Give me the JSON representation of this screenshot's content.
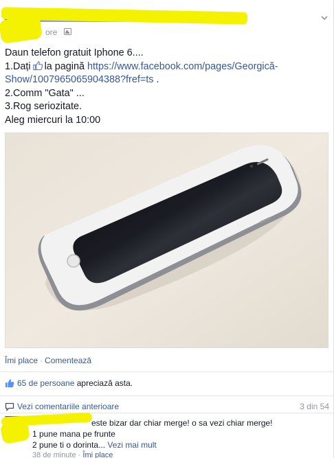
{
  "post": {
    "timestamp": "ore",
    "lines": {
      "l1": "Daun telefon gratuit Iphone 6....",
      "l2_a": "1.Dați",
      "l2_b": "la pagină",
      "l2_link": "https://www.facebook.com/pages/Georgică-",
      "l3_link": "Show/1007965065904388?fref=ts",
      "l3_end": " .",
      "l4": "2.Comm \"Gata\" ...",
      "l5": "3.Rog seriozitate.",
      "l6": "Aleg miercuri la 10:00"
    },
    "photo_alt": "iPhone 6"
  },
  "actions": {
    "like": "Îmi place",
    "comment": "Comentează",
    "sep": "·"
  },
  "likes": {
    "count_link": "65 de persoane",
    "suffix": " apreciază asta."
  },
  "comments": {
    "view_previous": "Vezi comentariile anterioare",
    "count": "3 din 54",
    "item": {
      "line1": "este bizar dar chiar merge! o sa vezi chiar merge!",
      "line2": "1 pune mana pe frunte",
      "line3": "2 pune ti o dorinta... ",
      "see_more": "Vezi mai mult",
      "time": "38 de minute",
      "like": "Îmi place"
    }
  },
  "colors": {
    "link": "#365899",
    "redaction": "#f4f200",
    "meta": "#90949c"
  }
}
